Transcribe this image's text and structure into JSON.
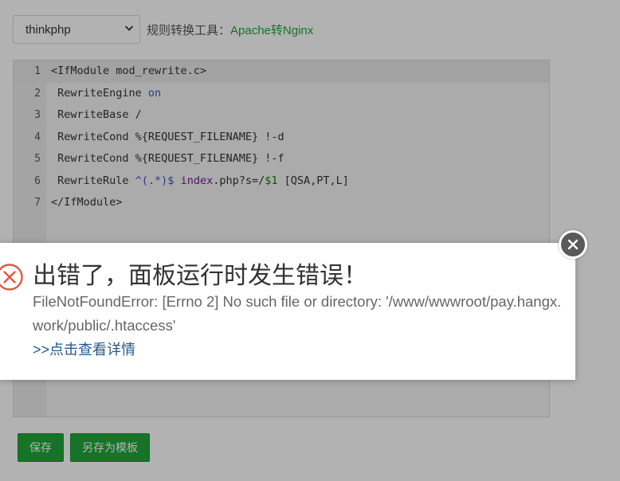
{
  "toolbar": {
    "selected_rule": "thinkphp",
    "label": "规则转换工具：",
    "link": "Apache转Nginx"
  },
  "editor": {
    "lines": [
      {
        "num": "1",
        "tokens": [
          [
            "plain",
            "<IfModule mod_rewrite.c>"
          ]
        ]
      },
      {
        "num": "2",
        "tokens": [
          [
            "plain",
            " RewriteEngine "
          ],
          [
            "kw",
            "on"
          ]
        ]
      },
      {
        "num": "3",
        "tokens": [
          [
            "plain",
            " RewriteBase /"
          ]
        ]
      },
      {
        "num": "4",
        "tokens": [
          [
            "plain",
            " RewriteCond %{REQUEST_FILENAME} !-d"
          ]
        ]
      },
      {
        "num": "5",
        "tokens": [
          [
            "plain",
            " RewriteCond %{REQUEST_FILENAME} !-f"
          ]
        ]
      },
      {
        "num": "6",
        "tokens": [
          [
            "plain",
            " RewriteRule "
          ],
          [
            "kw",
            "^(.*)$"
          ],
          [
            "plain",
            " "
          ],
          [
            "pu",
            "index"
          ],
          [
            "plain",
            ".php?s=/"
          ],
          [
            "nu",
            "$1"
          ],
          [
            "plain",
            " [QSA,PT,L]"
          ]
        ]
      },
      {
        "num": "7",
        "tokens": [
          [
            "plain",
            "</IfModule>"
          ]
        ]
      }
    ]
  },
  "actions": {
    "save": "保存",
    "save_as_template": "另存为模板"
  },
  "dialog": {
    "title": "出错了，面板运行时发生错误！",
    "message": "FileNotFoundError: [Errno 2] No such file or directory: '/www/wwwroot/pay.hangx.work/public/.htaccess'",
    "details_link": ">>点击查看详情"
  },
  "colors": {
    "accent": "#20a53a",
    "error": "#e8543f",
    "link": "#245a8c"
  },
  "icons": {
    "error": "error-circle-x-icon",
    "close": "close-icon",
    "dropdown": "chevron-down-icon"
  }
}
